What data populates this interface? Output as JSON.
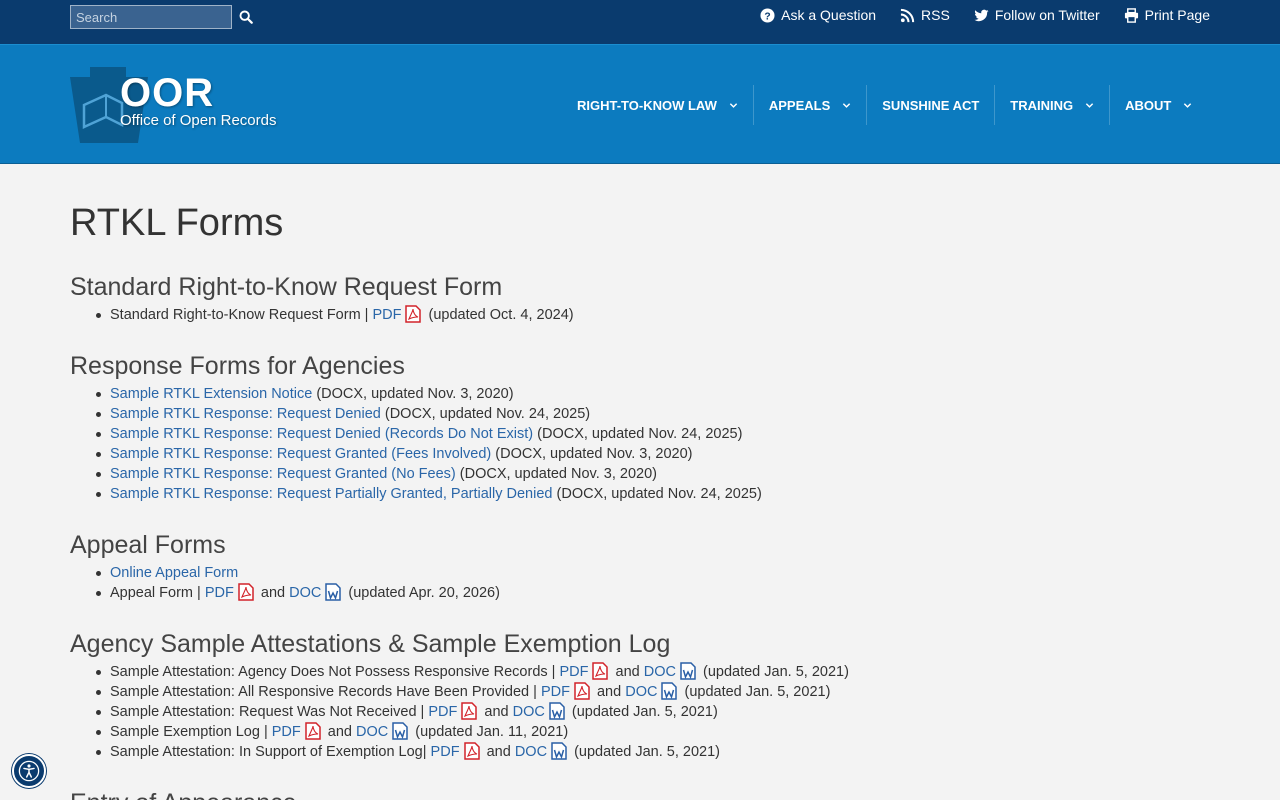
{
  "topbar": {
    "search_placeholder": "Search",
    "links": [
      "Ask a Question",
      "RSS",
      "Follow on Twitter",
      "Print Page"
    ]
  },
  "header": {
    "logo_acronym": "OOR",
    "logo_name": "Office of Open Records",
    "nav": [
      "RIGHT-TO-KNOW LAW",
      "APPEALS",
      "SUNSHINE ACT",
      "TRAINING",
      "ABOUT"
    ]
  },
  "page": {
    "title": "RTKL Forms",
    "sec_standard": {
      "heading": "Standard Right-to-Know Request Form",
      "items": [
        {
          "label": "Standard Right-to-Know Request Form |",
          "pdf": "PDF",
          "updated": "(updated Oct. 4, 2024)"
        }
      ]
    },
    "sec_response": {
      "heading": "Response Forms for Agencies",
      "items": [
        {
          "link": "Sample RTKL Extension Notice",
          "note": "(DOCX, updated Nov. 3, 2020)"
        },
        {
          "link": "Sample RTKL Response: Request Denied",
          "note": "(DOCX, updated Nov. 24, 2025)"
        },
        {
          "link": "Sample RTKL Response: Request Denied (Records Do Not Exist)",
          "note": "(DOCX, updated Nov. 24, 2025)"
        },
        {
          "link": "Sample RTKL Response: Request Granted (Fees Involved)",
          "note": "(DOCX, updated Nov. 3, 2020)"
        },
        {
          "link": "Sample RTKL Response: Request Granted (No Fees)",
          "note": "(DOCX, updated Nov. 3, 2020)"
        },
        {
          "link": "Sample RTKL Response: Request Partially Granted, Partially Denied",
          "note": "(DOCX, updated Nov. 24, 2025)"
        }
      ]
    },
    "sec_appeal": {
      "heading": "Appeal Forms",
      "online_link": "Online Appeal Form",
      "items": [
        {
          "label": "Appeal Form |",
          "pdf": "PDF",
          "and": "and",
          "doc": "DOC",
          "updated": "(updated Apr. 20, 2026)"
        }
      ]
    },
    "sec_attest": {
      "heading": "Agency Sample Attestations & Sample Exemption Log",
      "items": [
        {
          "label": "Sample Attestation: Agency Does Not Possess Responsive Records |",
          "pdf": "PDF",
          "and": "and",
          "doc": "DOC",
          "updated": "(updated Jan. 5, 2021)"
        },
        {
          "label": "Sample Attestation: All Responsive Records Have Been Provided |",
          "pdf": "PDF",
          "and": "and",
          "doc": "DOC",
          "updated": "(updated Jan. 5, 2021)"
        },
        {
          "label": "Sample Attestation: Request Was Not Received |",
          "pdf": "PDF",
          "and": "and",
          "doc": "DOC",
          "updated": "(updated Jan. 5, 2021)"
        },
        {
          "label": "Sample Exemption Log |",
          "pdf": "PDF",
          "and": "and",
          "doc": "DOC",
          "updated": "(updated Jan. 11, 2021)"
        },
        {
          "label": "Sample Attestation: In Support of Exemption Log|",
          "pdf": "PDF",
          "and": "and",
          "doc": "DOC",
          "updated": "(updated Jan. 5, 2021)"
        }
      ]
    },
    "sec_entry": {
      "heading": "Entry of Appearance"
    }
  },
  "colors": {
    "topbar": "#0a3b6e",
    "header": "#0c7bbf",
    "link": "#2a66a8",
    "pdf_icon": "#d2232a",
    "doc_icon": "#2a5fa6",
    "background": "#f3f3f3"
  }
}
